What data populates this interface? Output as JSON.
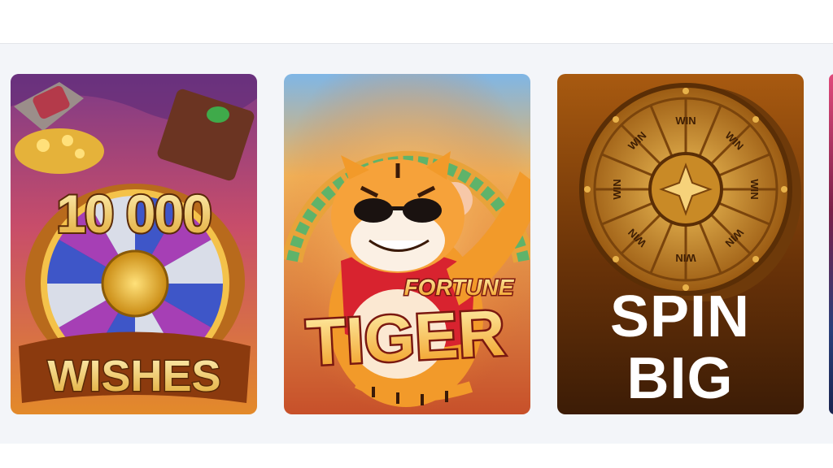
{
  "games": [
    {
      "number": "10 000",
      "title": "WISHES"
    },
    {
      "title_top": "FORTUNE",
      "title_main": "TIGER"
    },
    {
      "title_line1": "SPIN",
      "title_line2": "BIG",
      "wheel_label": "WIN"
    }
  ],
  "colors": {
    "page_background": "#f3f5f9",
    "spin_big_text": "#ffffff",
    "gold": "#e8b24a",
    "tiger_orange": "#f6921e"
  }
}
